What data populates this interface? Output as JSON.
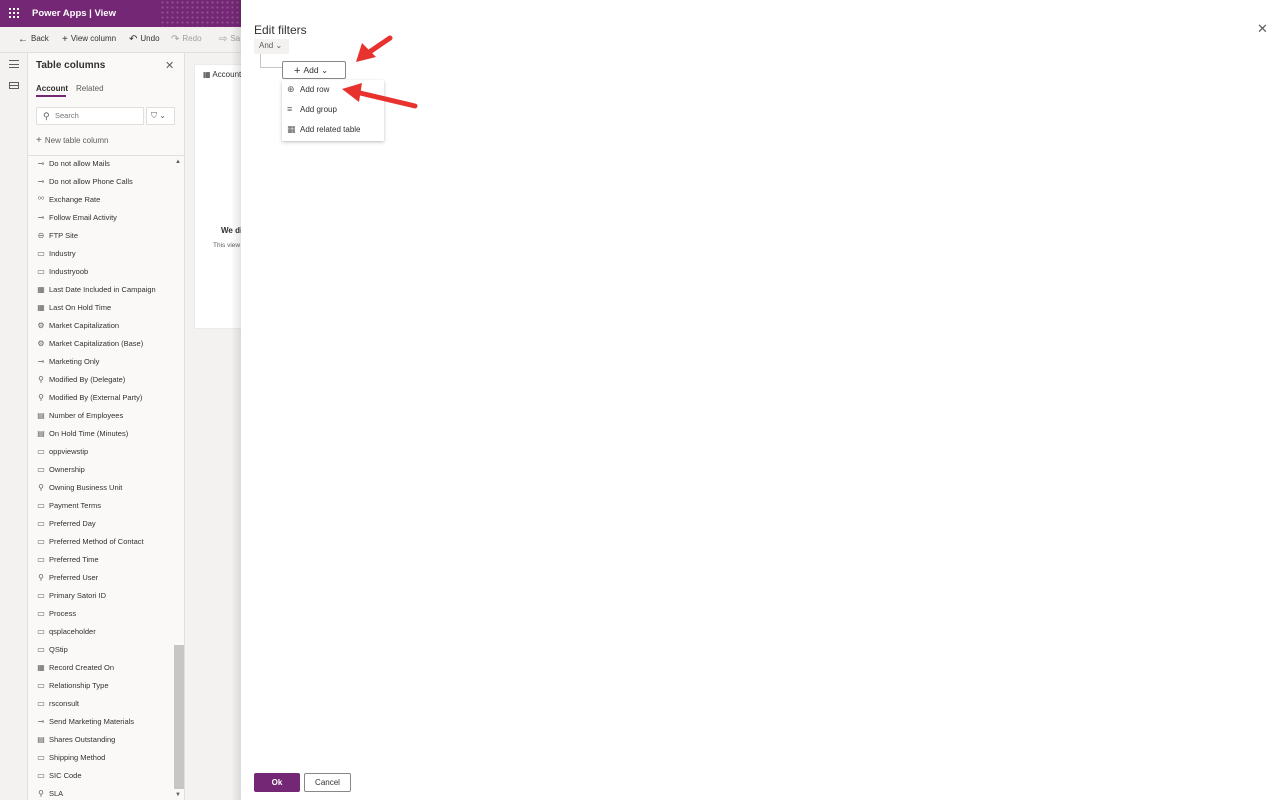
{
  "app": {
    "title": "Power Apps  |  View"
  },
  "toolbar": {
    "back": "Back",
    "view_column": "View column",
    "undo": "Undo",
    "redo": "Redo",
    "save_partial": "Sa"
  },
  "panel": {
    "title": "Table columns",
    "tabs": [
      "Account",
      "Related"
    ],
    "search_placeholder": "Search",
    "new_column": "New table column",
    "columns": [
      {
        "label": "Do not allow Mails",
        "icon": "toggle-icon"
      },
      {
        "label": "Do not allow Phone Calls",
        "icon": "toggle-icon"
      },
      {
        "label": "Exchange Rate",
        "icon": "decimal-icon"
      },
      {
        "label": "Follow Email Activity",
        "icon": "toggle-icon"
      },
      {
        "label": "FTP Site",
        "icon": "link-icon"
      },
      {
        "label": "Industry",
        "icon": "choice-icon"
      },
      {
        "label": "Industryoob",
        "icon": "text-icon"
      },
      {
        "label": "Last Date Included in Campaign",
        "icon": "calendar-icon"
      },
      {
        "label": "Last On Hold Time",
        "icon": "calendar-icon"
      },
      {
        "label": "Market Capitalization",
        "icon": "currency-icon"
      },
      {
        "label": "Market Capitalization (Base)",
        "icon": "currency-icon"
      },
      {
        "label": "Marketing Only",
        "icon": "toggle-icon"
      },
      {
        "label": "Modified By (Delegate)",
        "icon": "lookup-icon"
      },
      {
        "label": "Modified By (External Party)",
        "icon": "lookup-icon"
      },
      {
        "label": "Number of Employees",
        "icon": "number-icon"
      },
      {
        "label": "On Hold Time (Minutes)",
        "icon": "number-icon"
      },
      {
        "label": "oppviewstip",
        "icon": "text-icon"
      },
      {
        "label": "Ownership",
        "icon": "choice-icon"
      },
      {
        "label": "Owning Business Unit",
        "icon": "lookup-icon"
      },
      {
        "label": "Payment Terms",
        "icon": "choice-icon"
      },
      {
        "label": "Preferred Day",
        "icon": "choice-icon"
      },
      {
        "label": "Preferred Method of Contact",
        "icon": "choice-icon"
      },
      {
        "label": "Preferred Time",
        "icon": "choice-icon"
      },
      {
        "label": "Preferred User",
        "icon": "lookup-icon"
      },
      {
        "label": "Primary Satori ID",
        "icon": "text-icon"
      },
      {
        "label": "Process",
        "icon": "text-icon"
      },
      {
        "label": "qsplaceholder",
        "icon": "text-icon"
      },
      {
        "label": "QStip",
        "icon": "text-icon"
      },
      {
        "label": "Record Created On",
        "icon": "calendar-icon"
      },
      {
        "label": "Relationship Type",
        "icon": "choice-icon"
      },
      {
        "label": "rsconsult",
        "icon": "text-icon"
      },
      {
        "label": "Send Marketing Materials",
        "icon": "toggle-icon"
      },
      {
        "label": "Shares Outstanding",
        "icon": "number-icon"
      },
      {
        "label": "Shipping Method",
        "icon": "choice-icon"
      },
      {
        "label": "SIC Code",
        "icon": "text-icon"
      },
      {
        "label": "SLA",
        "icon": "lookup-icon"
      }
    ]
  },
  "canvas": {
    "card_header": "Account",
    "msg_title": "We di",
    "msg_body": "This view"
  },
  "modal": {
    "title": "Edit filters",
    "and_label": "And",
    "add_label": "Add",
    "menu": [
      "Add row",
      "Add group",
      "Add related table"
    ],
    "ok": "Ok",
    "cancel": "Cancel"
  },
  "colors": {
    "brand": "#742774",
    "annotation": "#e8322e"
  }
}
